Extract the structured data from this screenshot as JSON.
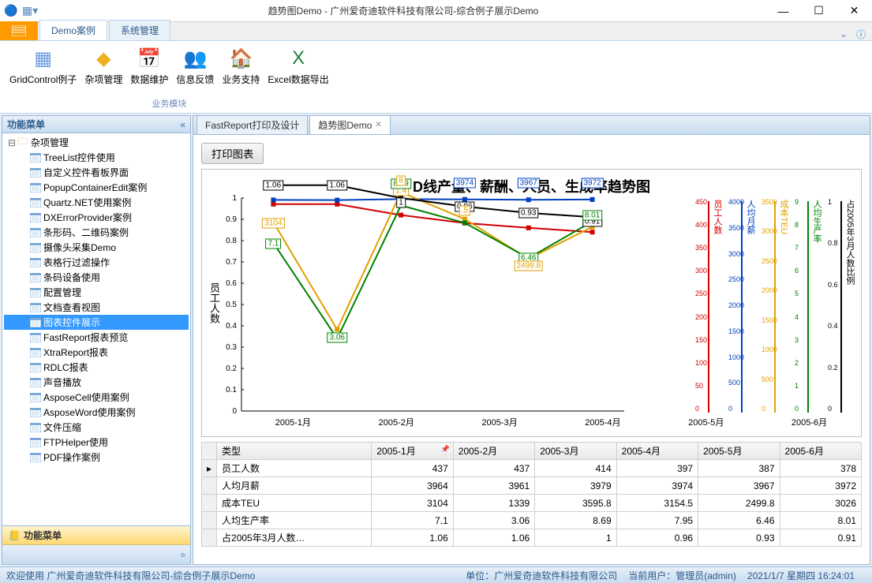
{
  "window": {
    "title": "趋势图Demo - 广州爱奇迪软件科技有限公司-综合例子展示Demo"
  },
  "ribbon": {
    "tabs": [
      {
        "label": "Demo案例",
        "active": true
      },
      {
        "label": "系统管理",
        "active": false
      }
    ],
    "items": [
      {
        "label": "GridControl例子",
        "icon_color": "#6a9ae0"
      },
      {
        "label": "杂项管理",
        "icon_color": "#f0b020"
      },
      {
        "label": "数据维护",
        "icon_color": "#e06060"
      },
      {
        "label": "信息反馈",
        "icon_color": "#6a9ae0"
      },
      {
        "label": "业务支持",
        "icon_color": "#e06060"
      },
      {
        "label": "Excel数据导出",
        "icon_color": "#208040"
      }
    ],
    "group_label": "业务模块"
  },
  "sidebar": {
    "title": "功能菜单",
    "root": "杂项管理",
    "items": [
      "TreeList控件使用",
      "自定义控件看板界面",
      "PopupContainerEdit案例",
      "Quartz.NET使用案例",
      "DXErrorProvider案例",
      "条形码、二维码案例",
      "摄像头采集Demo",
      "表格行过滤操作",
      "条码设备使用",
      "配置管理",
      "文档查看视图",
      "图表控件展示",
      "FastReport报表预览",
      "XtraReport报表",
      "RDLC报表",
      "声音播放",
      "AsposeCell使用案例",
      "AsposeWord使用案例",
      "文件压缩",
      "FTPHelper使用",
      "PDF操作案例"
    ],
    "selected_index": 11,
    "footer_btn": "功能菜单"
  },
  "doc_tabs": [
    {
      "label": "FastReport打印及设计",
      "active": false
    },
    {
      "label": "趋势图Demo",
      "active": true
    }
  ],
  "print_btn": "打印图表",
  "chart_title": "D线产量、薪酬、人员、生成率趋势图",
  "y_axis_label": "员工人数",
  "chart_data": {
    "type": "line",
    "categories": [
      "2005-1月",
      "2005-2月",
      "2005-3月",
      "2005-4月",
      "2005-5月",
      "2005-6月"
    ],
    "primary_axis": {
      "label": "员工人数",
      "min": 0,
      "max": 1,
      "step": 0.1
    },
    "secondary_axes": [
      {
        "label": "员工人数",
        "color": "#d00000",
        "min": 0,
        "max": 450,
        "ticks": [
          0,
          50,
          100,
          150,
          200,
          250,
          300,
          350,
          400,
          450
        ]
      },
      {
        "label": "人均月薪",
        "color": "#0040c0",
        "min": 0,
        "max": 4000,
        "ticks": [
          0,
          500,
          1000,
          1500,
          2000,
          2500,
          3000,
          3500,
          4000
        ]
      },
      {
        "label": "成本TEU",
        "color": "#e0a000",
        "min": 0,
        "max": 3500,
        "ticks": [
          0,
          500,
          1000,
          1500,
          2000,
          2500,
          3000,
          3500
        ]
      },
      {
        "label": "人均生产率",
        "color": "#008000",
        "min": 0,
        "max": 9,
        "ticks": [
          0,
          1,
          2,
          3,
          4,
          5,
          6,
          7,
          8,
          9
        ]
      },
      {
        "label": "占2005年3月人数比例",
        "color": "#000000",
        "min": 0,
        "max": 1,
        "ticks": [
          0,
          0.2,
          0.4,
          0.6,
          0.8,
          1
        ]
      }
    ],
    "series": [
      {
        "name": "员工人数",
        "color": "#d00000",
        "values": [
          437,
          437,
          414,
          397,
          387,
          378
        ]
      },
      {
        "name": "人均月薪",
        "color": "#0040c0",
        "values": [
          3964,
          3961,
          3979,
          3974,
          3967,
          3972
        ]
      },
      {
        "name": "成本TEU",
        "color": "#e0a000",
        "values": [
          3104,
          1339,
          3595.8,
          3154.5,
          2499.8,
          3026
        ]
      },
      {
        "name": "人均生产率",
        "color": "#008000",
        "values": [
          7.1,
          3.06,
          8.69,
          7.95,
          6.46,
          8.01
        ]
      },
      {
        "name": "占2005年3月人数比例",
        "color": "#000000",
        "values": [
          1.06,
          1.06,
          1,
          0.96,
          0.93,
          0.91
        ]
      }
    ],
    "data_labels": [
      {
        "x": 1,
        "norm_y": 1.06,
        "text": "1.06",
        "color": "#000000"
      },
      {
        "x": 2,
        "norm_y": 1.06,
        "text": "1.06",
        "color": "#000000"
      },
      {
        "x": 3,
        "norm_y": 0.979,
        "text": "1",
        "color": "#000000"
      },
      {
        "x": 3,
        "norm_y": 1.035,
        "text": "1.4",
        "color": "#e0a000"
      },
      {
        "x": 4,
        "norm_y": 0.96,
        "text": "0.96",
        "color": "#000000"
      },
      {
        "x": 5,
        "norm_y": 0.93,
        "text": "0.93",
        "color": "#000000"
      },
      {
        "x": 6,
        "norm_y": 0.89,
        "text": "0.91",
        "color": "#000000"
      },
      {
        "x": 1,
        "norm_y": 0.785,
        "text": "7.1",
        "color": "#008000"
      },
      {
        "x": 2,
        "norm_y": 0.345,
        "text": "3.06",
        "color": "#008000"
      },
      {
        "x": 3,
        "norm_y": 1.065,
        "text": "8.69",
        "color": "#008000"
      },
      {
        "x": 5,
        "norm_y": 0.72,
        "text": "6.46",
        "color": "#008000"
      },
      {
        "x": 6,
        "norm_y": 0.92,
        "text": "8.01",
        "color": "#008000"
      },
      {
        "x": 1,
        "norm_y": 0.88,
        "text": "3104",
        "color": "#e0a000"
      },
      {
        "x": 5,
        "norm_y": 0.68,
        "text": "2499.8",
        "color": "#e0a000"
      },
      {
        "x": 3,
        "norm_y": 1.095,
        "text": "8",
        "color": "#e0a000"
      },
      {
        "x": 4,
        "norm_y": 0.94,
        "text": ".5",
        "color": "#e0a000"
      },
      {
        "x": 4,
        "norm_y": 1.07,
        "text": "3974",
        "color": "#0040c0"
      },
      {
        "x": 5,
        "norm_y": 1.07,
        "text": "3967",
        "color": "#0040c0"
      },
      {
        "x": 6,
        "norm_y": 1.07,
        "text": "3972",
        "color": "#0040c0"
      }
    ]
  },
  "grid": {
    "columns": [
      "类型",
      "2005-1月",
      "2005-2月",
      "2005-3月",
      "2005-4月",
      "2005-5月",
      "2005-6月"
    ],
    "rows": [
      {
        "label": "员工人数",
        "values": [
          "437",
          "437",
          "414",
          "397",
          "387",
          "378"
        ]
      },
      {
        "label": "人均月薪",
        "values": [
          "3964",
          "3961",
          "3979",
          "3974",
          "3967",
          "3972"
        ]
      },
      {
        "label": "成本TEU",
        "values": [
          "3104",
          "1339",
          "3595.8",
          "3154.5",
          "2499.8",
          "3026"
        ]
      },
      {
        "label": "人均生产率",
        "values": [
          "7.1",
          "3.06",
          "8.69",
          "7.95",
          "6.46",
          "8.01"
        ]
      },
      {
        "label": "占2005年3月人数…",
        "values": [
          "1.06",
          "1.06",
          "1",
          "0.96",
          "0.93",
          "0.91"
        ]
      }
    ]
  },
  "status": {
    "left": "欢迎使用 广州爱奇迪软件科技有限公司-综合例子展示Demo",
    "company": "单位：广州爱奇迪软件科技有限公司",
    "user": "当前用户：管理员(admin)",
    "datetime": "2021/1/7 星期四 16:24:01"
  }
}
